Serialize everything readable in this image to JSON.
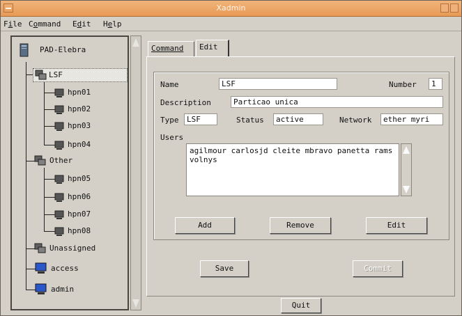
{
  "window": {
    "title": "Xadmin"
  },
  "menu": [
    {
      "label": "File",
      "underline": "i"
    },
    {
      "label": "Command",
      "underline": "o"
    },
    {
      "label": "Edit",
      "underline": "d"
    },
    {
      "label": "Help",
      "underline": "e"
    }
  ],
  "tree": {
    "root": "PAD-Elebra",
    "groups": {
      "lsf": {
        "label": "LSF",
        "nodes": [
          "hpn01",
          "hpn02",
          "hpn03",
          "hpn04"
        ]
      },
      "other": {
        "label": "Other",
        "nodes": [
          "hpn05",
          "hpn06",
          "hpn07",
          "hpn08"
        ]
      },
      "unassigned": {
        "label": "Unassigned"
      },
      "access": {
        "label": "access"
      },
      "admin": {
        "label": "admin"
      }
    }
  },
  "tabs": [
    "Command",
    "Edit"
  ],
  "form": {
    "name_label": "Name",
    "name_value": "LSF",
    "number_label": "Number",
    "number_value": "1",
    "description_label": "Description",
    "description_value": "Particao unica",
    "type_label": "Type",
    "type_value": "LSF",
    "status_label": "Status",
    "status_value": "active",
    "network_label": "Network",
    "network_value": "ether myri",
    "users_label": "Users",
    "users_value": "agilmour carlosjd cleite mbravo panetta rams volnys"
  },
  "buttons": {
    "add": "Add",
    "remove": "Remove",
    "edit": "Edit",
    "save": "Save",
    "commit": "Commit",
    "quit": "Quit"
  },
  "colors": {
    "titlebar": "#e89a56",
    "panel": "#d4d0c8"
  }
}
